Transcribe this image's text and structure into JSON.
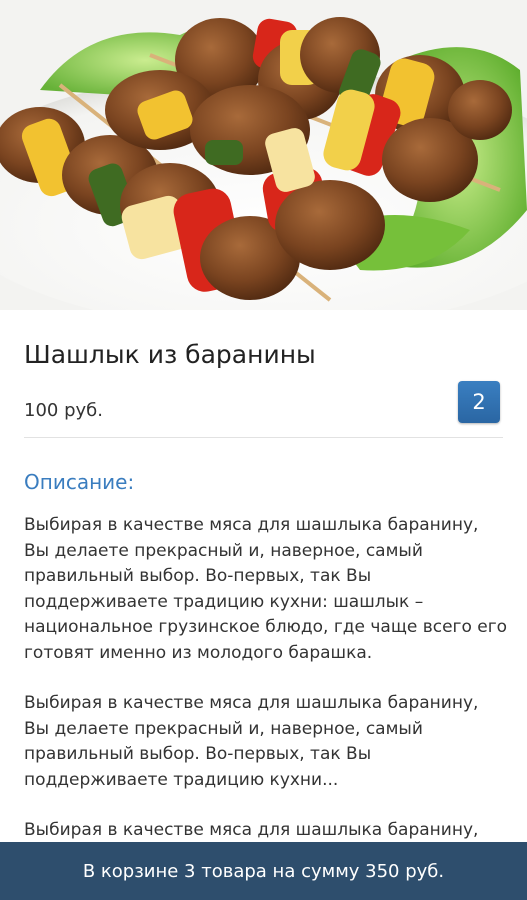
{
  "dish": {
    "title": "Шашлык из баранины",
    "price": "100 руб.",
    "quantity": "2",
    "image_icon": "kebab-photo"
  },
  "description": {
    "heading": "Описание:",
    "paragraphs": [
      "Выбирая в качестве мяса для шашлыка баранину, Вы делаете прекрасный и, наверное, самый правильный выбор. Во-первых, так Вы поддерживаете традицию кухни: шашлык – национальное грузинское блюдо, где чаще всего его готовят именно из молодого барашка.",
      "Выбирая в качестве мяса для шашлыка баранину, Вы делаете прекрасный и, наверное, самый правильный выбор. Во-первых, так Вы поддерживаете традицию кухни...",
      "Выбирая в качестве мяса для шашлыка баранину, Вы делаете прекрасный и, наверное,"
    ]
  },
  "cart": {
    "summary": "В корзине 3 товара на сумму 350 руб."
  },
  "colors": {
    "accent": "#3a7dbf",
    "badge": "#2f6eab",
    "cart_bar": "#2e4e6d"
  }
}
